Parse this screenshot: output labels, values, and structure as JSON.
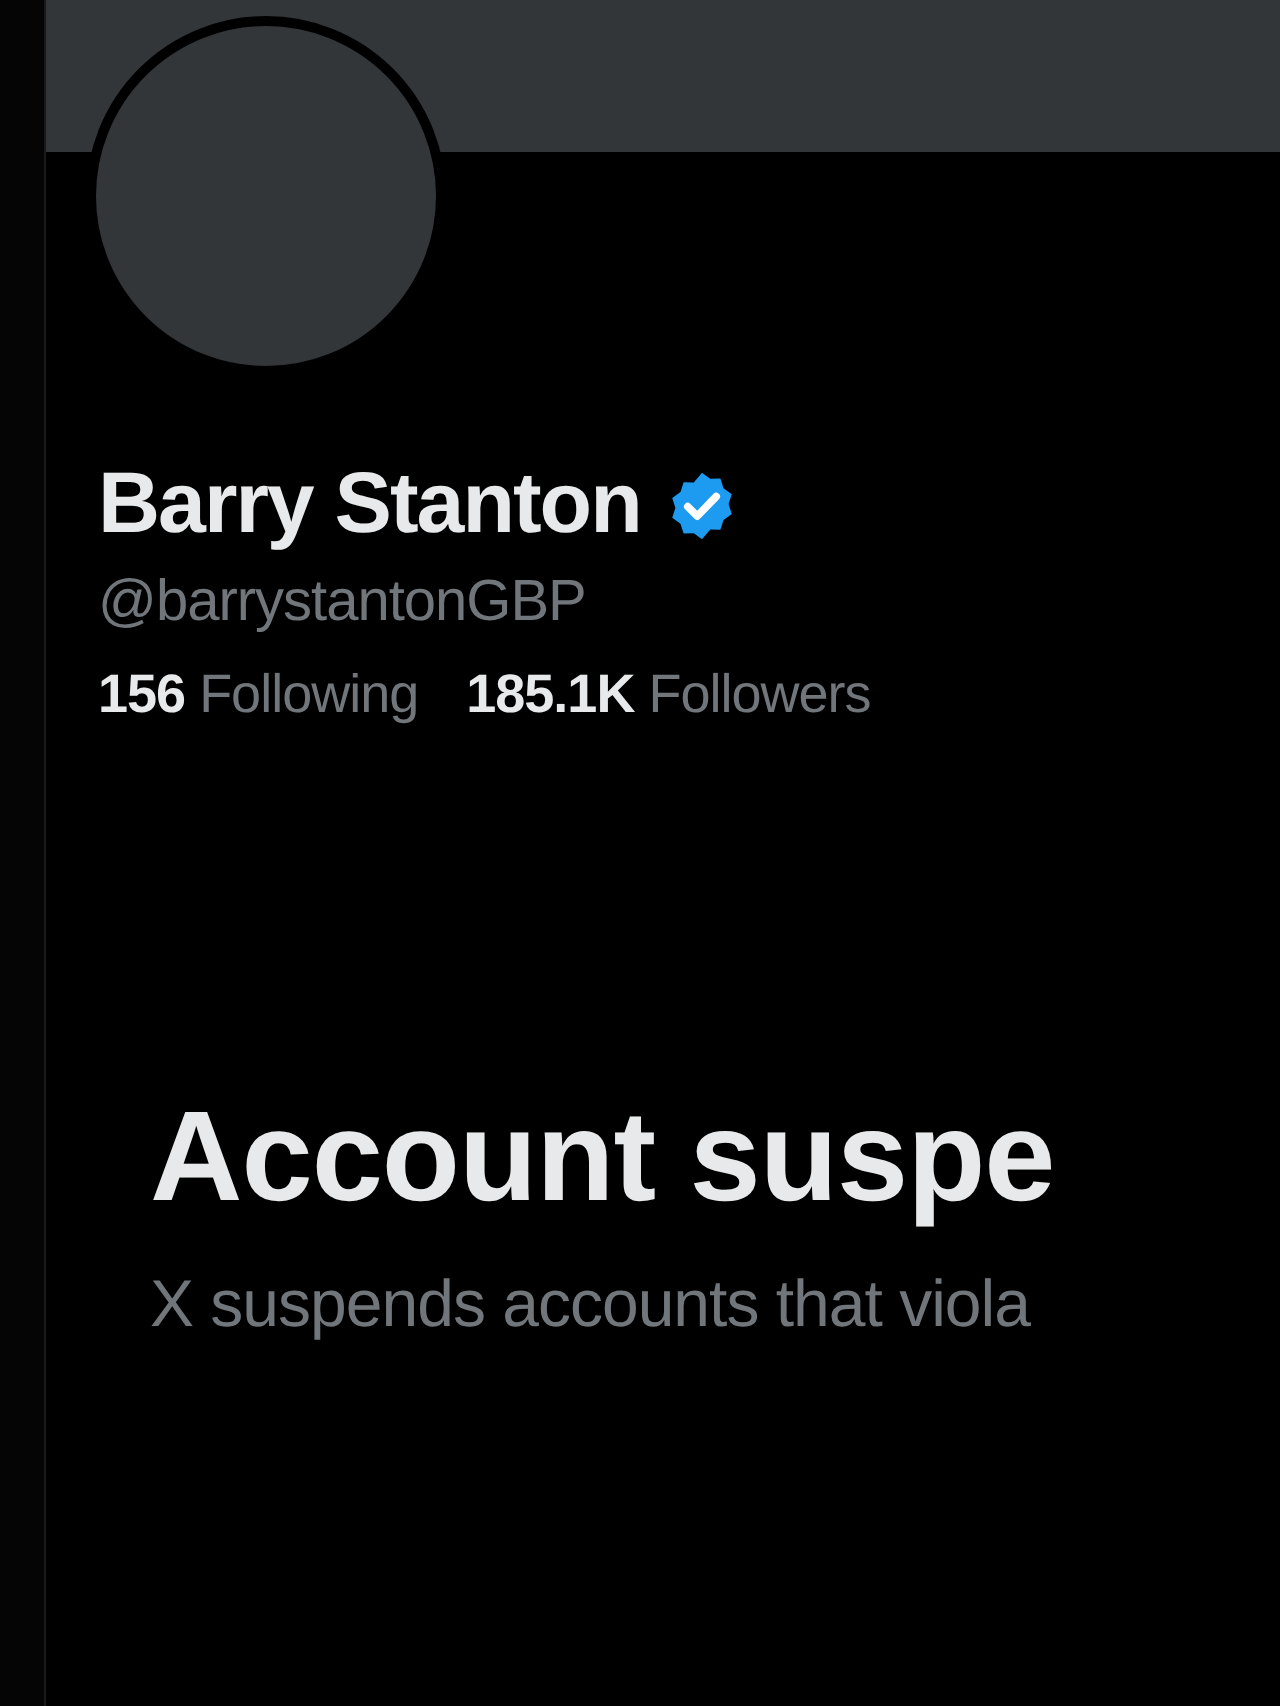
{
  "profile": {
    "name": "Barry Stanton",
    "verified": true,
    "handle": "@barrystantonGBP",
    "stats": [
      {
        "count": "156",
        "label": "Following"
      },
      {
        "count": "185.1K",
        "label": "Followers"
      }
    ]
  },
  "notice": {
    "title": "Account suspe",
    "text": "X suspends accounts that viola"
  }
}
